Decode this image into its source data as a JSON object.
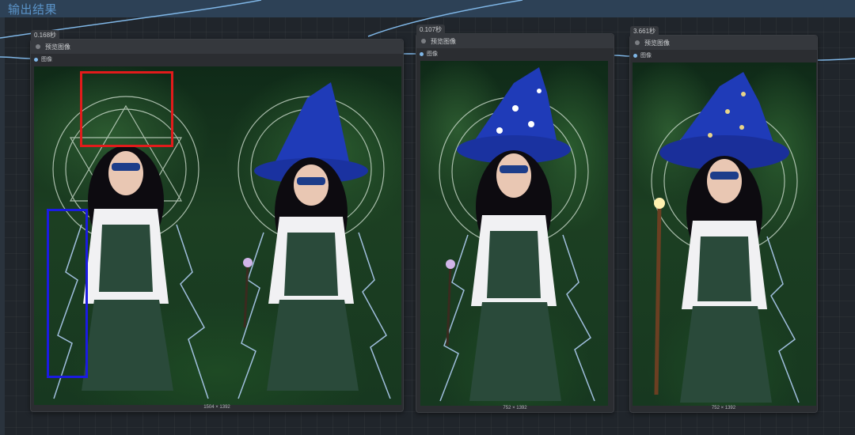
{
  "group": {
    "title": "输出结果"
  },
  "nodes": [
    {
      "timing": "0.168秒",
      "title": "预览图像",
      "input_label": "图像",
      "size": "1504 × 1392"
    },
    {
      "timing": "0.107秒",
      "title": "预览图像",
      "input_label": "图像",
      "size": "752 × 1392"
    },
    {
      "timing": "3.661秒",
      "title": "预览图像",
      "input_label": "图像",
      "size": "752 × 1392"
    }
  ],
  "colors": {
    "group_bar": "#2d4156",
    "link": "#7fb6e6",
    "hat": "#1f3bb8",
    "red_box": "#e21b1b",
    "blue_box": "#1b1be2"
  }
}
